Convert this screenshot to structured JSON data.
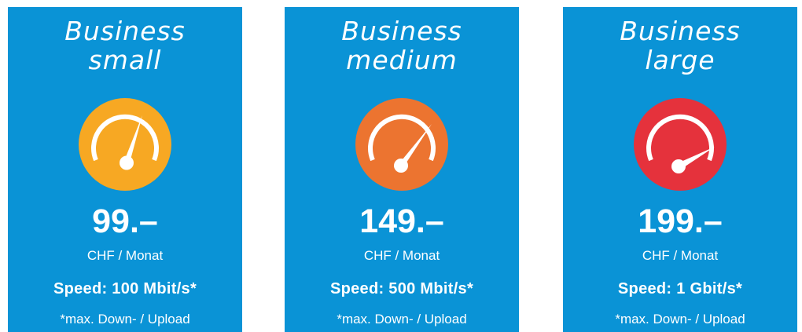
{
  "plans": [
    {
      "name_line1": "Business",
      "name_line2": "small",
      "gauge_color": "#f7a823",
      "gauge_level": "low",
      "price": "99.–",
      "unit": "CHF / Monat",
      "speed": "Speed: 100 Mbit/s*",
      "note": "*max. Down- / Upload"
    },
    {
      "name_line1": "Business",
      "name_line2": "medium",
      "gauge_color": "#ec7430",
      "gauge_level": "medium",
      "price": "149.–",
      "unit": "CHF / Monat",
      "speed": "Speed: 500 Mbit/s*",
      "note": "*max. Down- / Upload"
    },
    {
      "name_line1": "Business",
      "name_line2": "large",
      "gauge_color": "#e5323c",
      "gauge_level": "high",
      "price": "199.–",
      "unit": "CHF / Monat",
      "speed": "Speed: 1 Gbit/s*",
      "note": "*max. Down- / Upload"
    }
  ],
  "colors": {
    "card_background": "#0a93d6",
    "text": "#ffffff"
  }
}
